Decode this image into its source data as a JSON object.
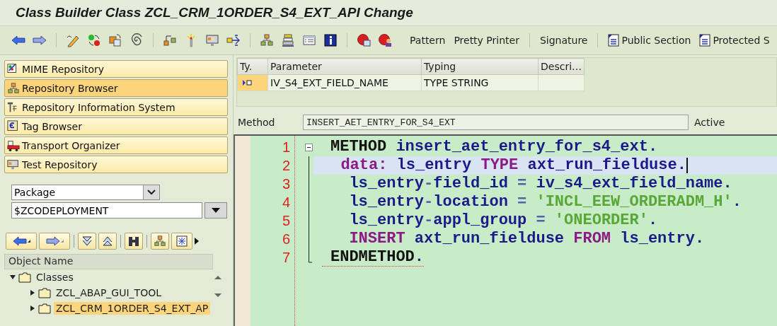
{
  "window": {
    "title": "Class Builder Class ZCL_CRM_1ORDER_S4_EXT_API Change"
  },
  "toolbar": {
    "text_buttons": [
      {
        "label": "Pattern",
        "kind": "plain",
        "divider_after": false
      },
      {
        "label": "Pretty Printer",
        "kind": "plain",
        "divider_after": true
      },
      {
        "label": "Signature",
        "kind": "plain",
        "divider_after": true
      },
      {
        "label": "Public Section",
        "kind": "section",
        "divider_after": false
      },
      {
        "label": "Protected S",
        "kind": "section",
        "divider_after": false
      }
    ]
  },
  "navigator": {
    "items": [
      {
        "label": "MIME Repository",
        "kind": "mime",
        "selected": false
      },
      {
        "label": "Repository Browser",
        "kind": "browser",
        "selected": true
      },
      {
        "label": "Repository Information System",
        "kind": "info",
        "selected": false
      },
      {
        "label": "Tag Browser",
        "kind": "tag",
        "selected": false
      },
      {
        "label": "Transport Organizer",
        "kind": "transport",
        "selected": false
      },
      {
        "label": "Test Repository",
        "kind": "test",
        "selected": false
      }
    ]
  },
  "object_list": {
    "type_selector": "Package",
    "package_field": "$ZCODEPLOYMENT",
    "header": "Object Name",
    "tree": [
      {
        "label": "Classes",
        "expanded": true,
        "selected": false,
        "children": [
          {
            "label": "ZCL_ABAP_GUI_TOOL",
            "expanded": false,
            "selected": false
          },
          {
            "label": "ZCL_CRM_1ORDER_S4_EXT_AP",
            "expanded": false,
            "selected": true
          }
        ]
      }
    ]
  },
  "parameters": {
    "columns": [
      "Ty.",
      "Parameter",
      "Typing",
      "Descri…"
    ],
    "rows": [
      {
        "parameter": "IV_S4_EXT_FIELD_NAME",
        "typing": "TYPE STRING"
      }
    ]
  },
  "method": {
    "label": "Method",
    "name": "INSERT_AET_ENTRY_FOR_S4_EXT",
    "status": "Active"
  },
  "editor": {
    "lines": [
      {
        "number": "1",
        "current": false,
        "kind": "start",
        "tokens": [
          {
            "kind": "block",
            "text": "METHOD"
          },
          {
            "kind": "name",
            "text": " insert_aet_entry_for_s4_ext."
          }
        ]
      },
      {
        "number": "2",
        "current": true,
        "kind": "inner",
        "tokens": [
          {
            "kind": "keyword",
            "text": "  data:"
          },
          {
            "kind": "name",
            "text": " ls_entry "
          },
          {
            "kind": "keyword",
            "text": "TYPE"
          },
          {
            "kind": "name",
            "text": " axt_run_fielduse."
          }
        ]
      },
      {
        "number": "3",
        "current": false,
        "kind": "inner",
        "tokens": [
          {
            "kind": "name",
            "text": "  ls_entry"
          },
          {
            "kind": "operator",
            "text": "-"
          },
          {
            "kind": "name",
            "text": "field_id "
          },
          {
            "kind": "operator",
            "text": "="
          },
          {
            "kind": "name",
            "text": " iv_s4_ext_field_name."
          }
        ]
      },
      {
        "number": "4",
        "current": false,
        "kind": "inner",
        "tokens": [
          {
            "kind": "name",
            "text": "  ls_entry"
          },
          {
            "kind": "operator",
            "text": "-"
          },
          {
            "kind": "name",
            "text": "location "
          },
          {
            "kind": "operator",
            "text": "="
          },
          {
            "kind": "literal",
            "text": " 'INCL_EEW_ORDERADM_H'"
          },
          {
            "kind": "name",
            "text": "."
          }
        ]
      },
      {
        "number": "5",
        "current": false,
        "kind": "inner",
        "tokens": [
          {
            "kind": "name",
            "text": "  ls_entry"
          },
          {
            "kind": "operator",
            "text": "-"
          },
          {
            "kind": "name",
            "text": "appl_group "
          },
          {
            "kind": "operator",
            "text": "="
          },
          {
            "kind": "literal",
            "text": " 'ONEORDER'"
          },
          {
            "kind": "name",
            "text": "."
          }
        ]
      },
      {
        "number": "6",
        "current": false,
        "kind": "inner",
        "tokens": [
          {
            "kind": "keyword",
            "text": "  INSERT"
          },
          {
            "kind": "name",
            "text": " axt_run_fielduse "
          },
          {
            "kind": "keyword",
            "text": "FROM"
          },
          {
            "kind": "name",
            "text": " ls_entry."
          }
        ]
      },
      {
        "number": "7",
        "current": false,
        "kind": "end",
        "tokens": [
          {
            "kind": "block",
            "text": "ENDMETHOD"
          },
          {
            "kind": "name",
            "text": "."
          }
        ]
      }
    ]
  }
}
